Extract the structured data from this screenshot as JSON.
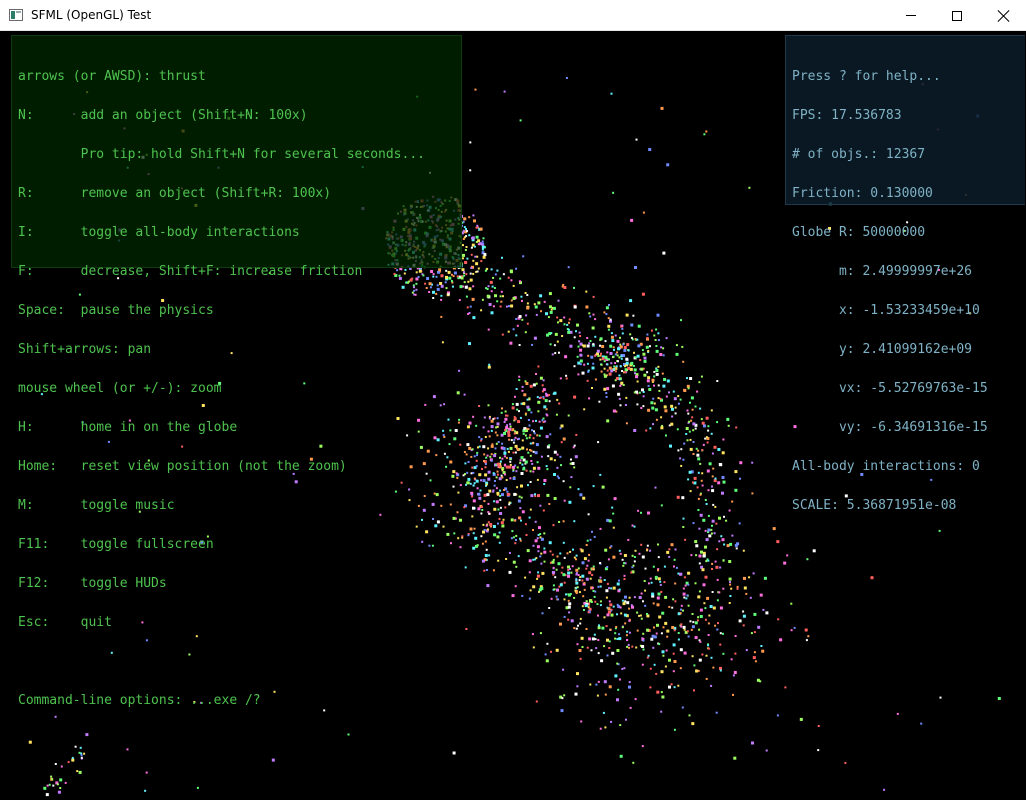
{
  "window": {
    "title": "SFML (OpenGL) Test",
    "controls": {
      "minimize": "minimize",
      "maximize": "maximize",
      "close": "close"
    }
  },
  "help_hud": {
    "lines": [
      "arrows (or AWSD): thrust",
      "N:      add an object (Shift+N: 100x)",
      "        Pro tip: hold Shift+N for several seconds...",
      "R:      remove an object (Shift+R: 100x)",
      "I:      toggle all-body interactions",
      "F:      decrease, Shift+F: increase friction",
      "Space:  pause the physics",
      "Shift+arrows: pan",
      "mouse wheel (or +/-): zoom",
      "H:      home in on the globe",
      "Home:   reset view position (not the zoom)",
      "M:      toggle music",
      "F11:    toggle fullscreen",
      "F12:    toggle HUDs",
      "Esc:    quit"
    ],
    "footer": "Command-line options: ...exe /?"
  },
  "stats_hud": {
    "help_hint": "Press ? for help...",
    "fps": "FPS: 17.536783",
    "objects": "# of objs.: 12367",
    "friction": "Friction: 0.130000",
    "globe_r": "Globe R: 50000000",
    "mass": "      m: 2.49999997e+26",
    "x": "      x: -1.53233459e+10",
    "y": "      y: 2.41099162e+09",
    "vx": "      vx: -5.52769763e-15",
    "vy": "      vy: -6.34691316e-15",
    "interactions": "All-body interactions: 0",
    "scale": "SCALE: 5.36871951e-08"
  },
  "colors": {
    "help_text": "#4ec24e",
    "stats_text": "#7fb2c6",
    "background": "#000000"
  }
}
